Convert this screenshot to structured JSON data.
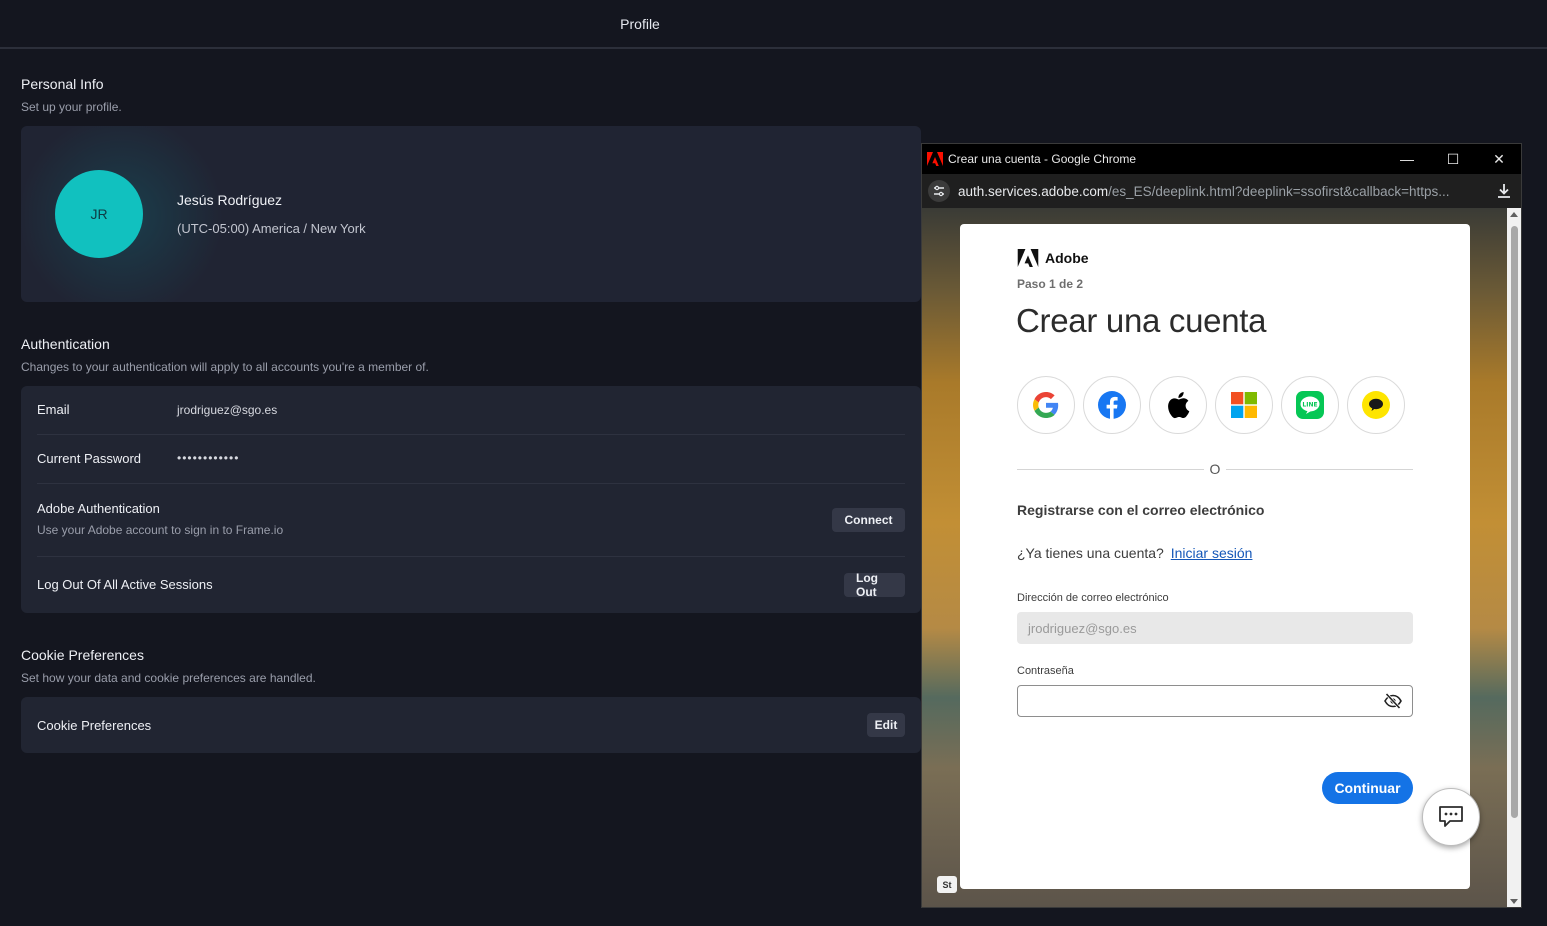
{
  "topbar": {
    "title": "Profile"
  },
  "personal": {
    "heading": "Personal Info",
    "subheading": "Set up your profile.",
    "initials": "JR",
    "name": "Jesús Rodríguez",
    "timezone": "(UTC-05:00) America / New York",
    "avatar_color": "#11c1bf"
  },
  "auth": {
    "heading": "Authentication",
    "subheading": "Changes to your authentication will apply to all accounts you're a member of.",
    "email_label": "Email",
    "email_value": "jrodriguez@sgo.es",
    "password_label": "Current Password",
    "password_value": "••••••••••••",
    "adobe_label": "Adobe Authentication",
    "adobe_sub": "Use your Adobe account to sign in to Frame.io",
    "connect_label": "Connect",
    "logout_all_label": "Log Out Of All Active Sessions",
    "logout_label": "Log Out"
  },
  "cookies": {
    "heading": "Cookie Preferences",
    "subheading": "Set how your data and cookie preferences are handled.",
    "row_label": "Cookie Preferences",
    "edit_label": "Edit"
  },
  "popup": {
    "window_title": "Crear una cuenta - Google Chrome",
    "url_host": "auth.services.adobe.com",
    "url_path": "/es_ES/deeplink.html?deeplink=ssofirst&callback=https...",
    "minimize": "—",
    "maximize": "☐",
    "close": "✕",
    "st_badge": "St"
  },
  "adobe_form": {
    "brand": "Adobe",
    "step": "Paso 1 de 2",
    "title": "Crear una cuenta",
    "social_icons": [
      "google-icon",
      "facebook-icon",
      "apple-icon",
      "microsoft-icon",
      "line-icon",
      "kakao-icon"
    ],
    "divider_label": "O",
    "register_email": "Registrarse con el correo electrónico",
    "have_account": "¿Ya tienes una cuenta?",
    "signin_link": "Iniciar sesión",
    "email_label": "Dirección de correo electrónico",
    "email_value": "jrodriguez@sgo.es",
    "password_label": "Contraseña",
    "continue_label": "Continuar",
    "accent": "#1473e6"
  }
}
